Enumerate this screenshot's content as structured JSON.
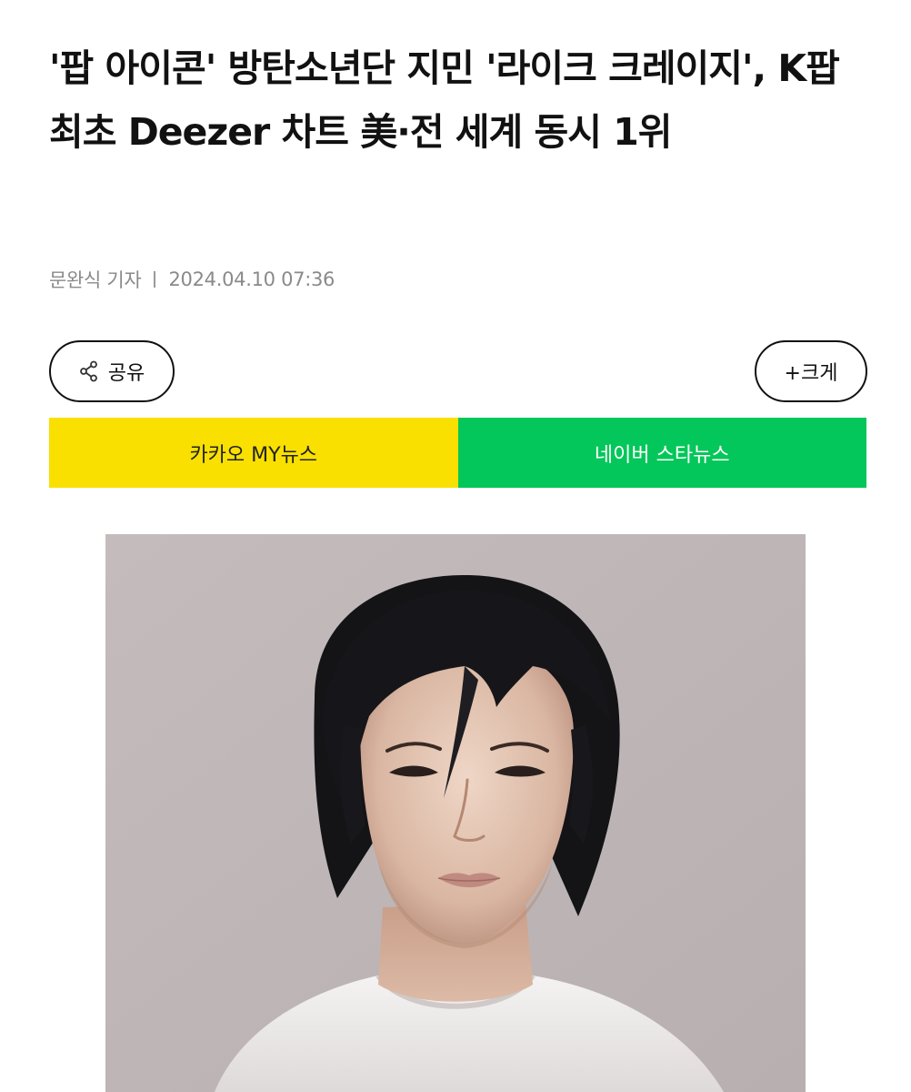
{
  "article": {
    "headline": "'팝 아이콘' 방탄소년단 지민 '라이크 크레이지', K팝 최초 Deezer 차트 美·전 세계 동시 1위",
    "reporter": "문완식 기자",
    "datetime": "2024.04.10 07:36"
  },
  "toolbar": {
    "share_label": "공유",
    "share_icon": "share-icon",
    "bigger_label": "+크게"
  },
  "news_links": {
    "kakao_label": "카카오 MY뉴스",
    "naver_label": "네이버 스타뉴스"
  },
  "colors": {
    "kakao": "#f9e000",
    "naver": "#03c75a"
  }
}
